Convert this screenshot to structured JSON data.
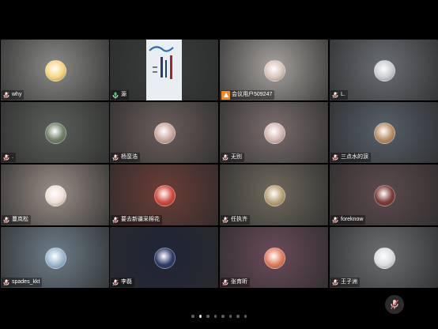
{
  "participants": [
    {
      "name": "why",
      "bg": "#8a8a88",
      "avatar": "#f6d47a",
      "mic": "muted"
    },
    {
      "name": "源",
      "bg": "#3a3f3d",
      "avatar": "",
      "mic": "on",
      "active": true,
      "slide": true
    },
    {
      "name": "会议用户509247",
      "bg": "#a6a29e",
      "avatar": "#d9c4b8",
      "mic": "host"
    },
    {
      "name": "L.",
      "bg": "#6a6e74",
      "avatar": "#c9ccd1",
      "mic": "muted"
    },
    {
      "name": ".",
      "bg": "#5b5f5a",
      "avatar": "#6f7f64",
      "mic": "muted"
    },
    {
      "name": "杨蛮浩",
      "bg": "#6a5f5b",
      "avatar": "#c9a79a",
      "mic": "muted"
    },
    {
      "name": "无别",
      "bg": "#7a6e6e",
      "avatar": "#d4b6b0",
      "mic": "muted"
    },
    {
      "name": "三点水的淚",
      "bg": "#57606a",
      "avatar": "#b58d62",
      "mic": "muted"
    },
    {
      "name": "蔓岚松",
      "bg": "#9a8f88",
      "avatar": "#eddfd4",
      "mic": "muted"
    },
    {
      "name": "要去新疆采棉花",
      "bg": "#6b3d36",
      "avatar": "#d0473a",
      "mic": "muted"
    },
    {
      "name": "任执齐",
      "bg": "#6f6a5e",
      "avatar": "#b6a073",
      "mic": "muted"
    },
    {
      "name": "foreknow",
      "bg": "#5d4b4e",
      "avatar": "#7a3a34",
      "mic": "muted"
    },
    {
      "name": "spades_kkt",
      "bg": "#6e7e8a",
      "avatar": "#9bb6cf",
      "mic": "muted"
    },
    {
      "name": "李磊",
      "bg": "#1f2538",
      "avatar": "#2a3a66",
      "mic": "muted"
    },
    {
      "name": "张育昕",
      "bg": "#6a4b5a",
      "avatar": "#e07a5a",
      "mic": "muted"
    },
    {
      "name": "王子洲",
      "bg": "#6c6f72",
      "avatar": "#dcdde0",
      "mic": "muted"
    }
  ],
  "pagination": {
    "count": 8,
    "current": 1
  },
  "colors": {
    "active_border": "#2ecf6d",
    "muted_mic": "#e25a5a",
    "host_badge": "#f08a1c"
  }
}
